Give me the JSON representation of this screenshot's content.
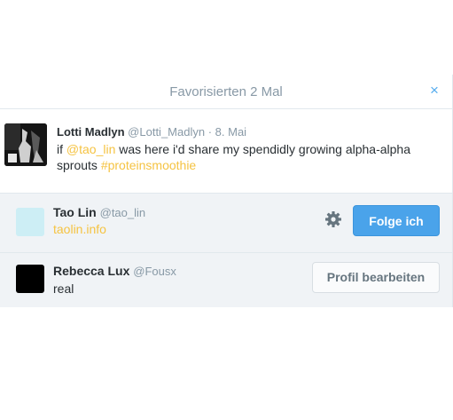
{
  "modal": {
    "title": "Favorisierten 2 Mal",
    "close_symbol": "×"
  },
  "tweet": {
    "name": "Lotti Madlyn",
    "handle": "@Lotti_Madlyn",
    "separator": "·",
    "date": "8. Mai",
    "text_1": "if ",
    "mention": "@tao_lin",
    "text_2": " was here i'd share my spendidly growing alpha-alpha sprouts ",
    "hashtag": "#proteinsmoothie"
  },
  "users": [
    {
      "name": "Tao Lin",
      "handle": "@tao_lin",
      "link": "taolin.info",
      "button": "Folge ich",
      "avatar_color": "#cdeef5",
      "icon": "gear-icon"
    },
    {
      "name": "Rebecca Lux",
      "handle": "@Fousx",
      "bio": "real",
      "button": "Profil bearbeiten",
      "avatar_color": "#000000"
    }
  ],
  "colors": {
    "accent_blue": "#55acee",
    "follow_button": "#4aa3ea",
    "link_yellow": "#f5c342",
    "row_background": "#f0f3f6"
  }
}
